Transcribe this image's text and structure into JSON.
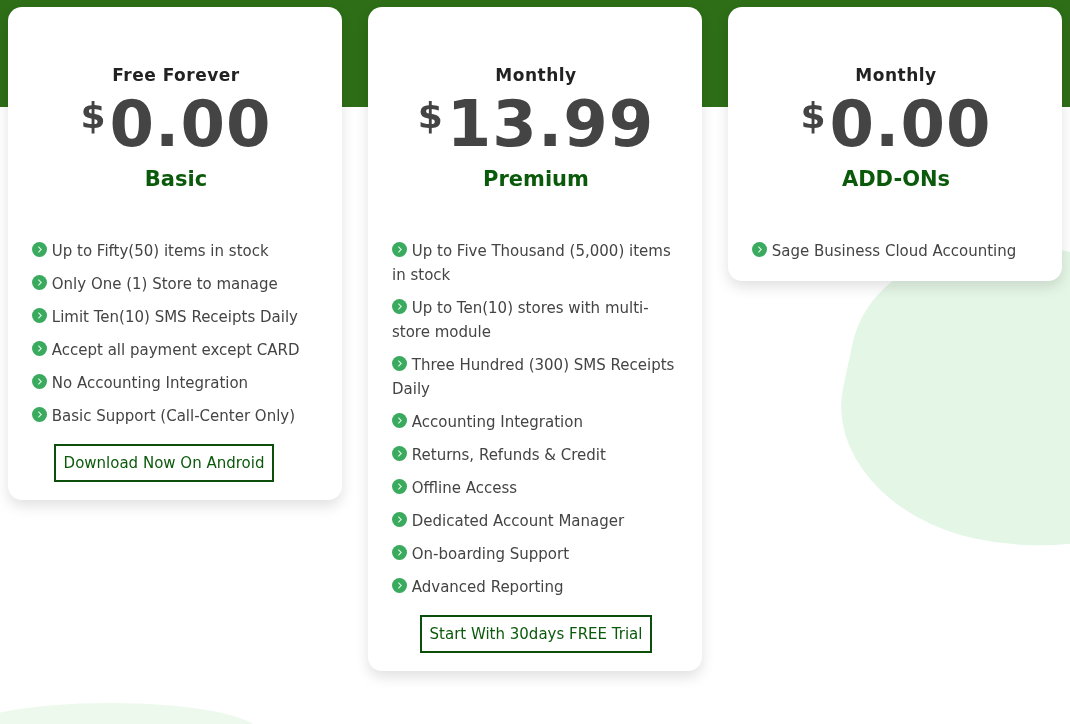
{
  "plans": [
    {
      "period": "Free Forever",
      "currency": "$",
      "price": "0.00",
      "name": "Basic",
      "features": [
        "Up to Fifty(50) items in stock",
        "Only One (1) Store to manage",
        "Limit Ten(10) SMS Receipts Daily",
        "Accept all payment except CARD",
        "No Accounting Integration",
        "Basic Support (Call-Center Only)"
      ],
      "button": "Download Now On Android"
    },
    {
      "period": "Monthly",
      "currency": "$",
      "price": "13.99",
      "name": "Premium",
      "features": [
        "Up to Five Thousand (5,000) items in stock",
        "Up to Ten(10) stores with multi-store module",
        "Three Hundred (300) SMS Receipts Daily",
        "Accounting Integration",
        "Returns, Refunds & Credit",
        "Offline Access",
        "Dedicated Account Manager",
        "On-boarding Support",
        "Advanced Reporting"
      ],
      "button": "Start With 30days FREE Trial"
    },
    {
      "period": "Monthly",
      "currency": "$",
      "price": "0.00",
      "name": "ADD-ONs",
      "features": [
        "Sage Business Cloud Accounting"
      ]
    }
  ]
}
